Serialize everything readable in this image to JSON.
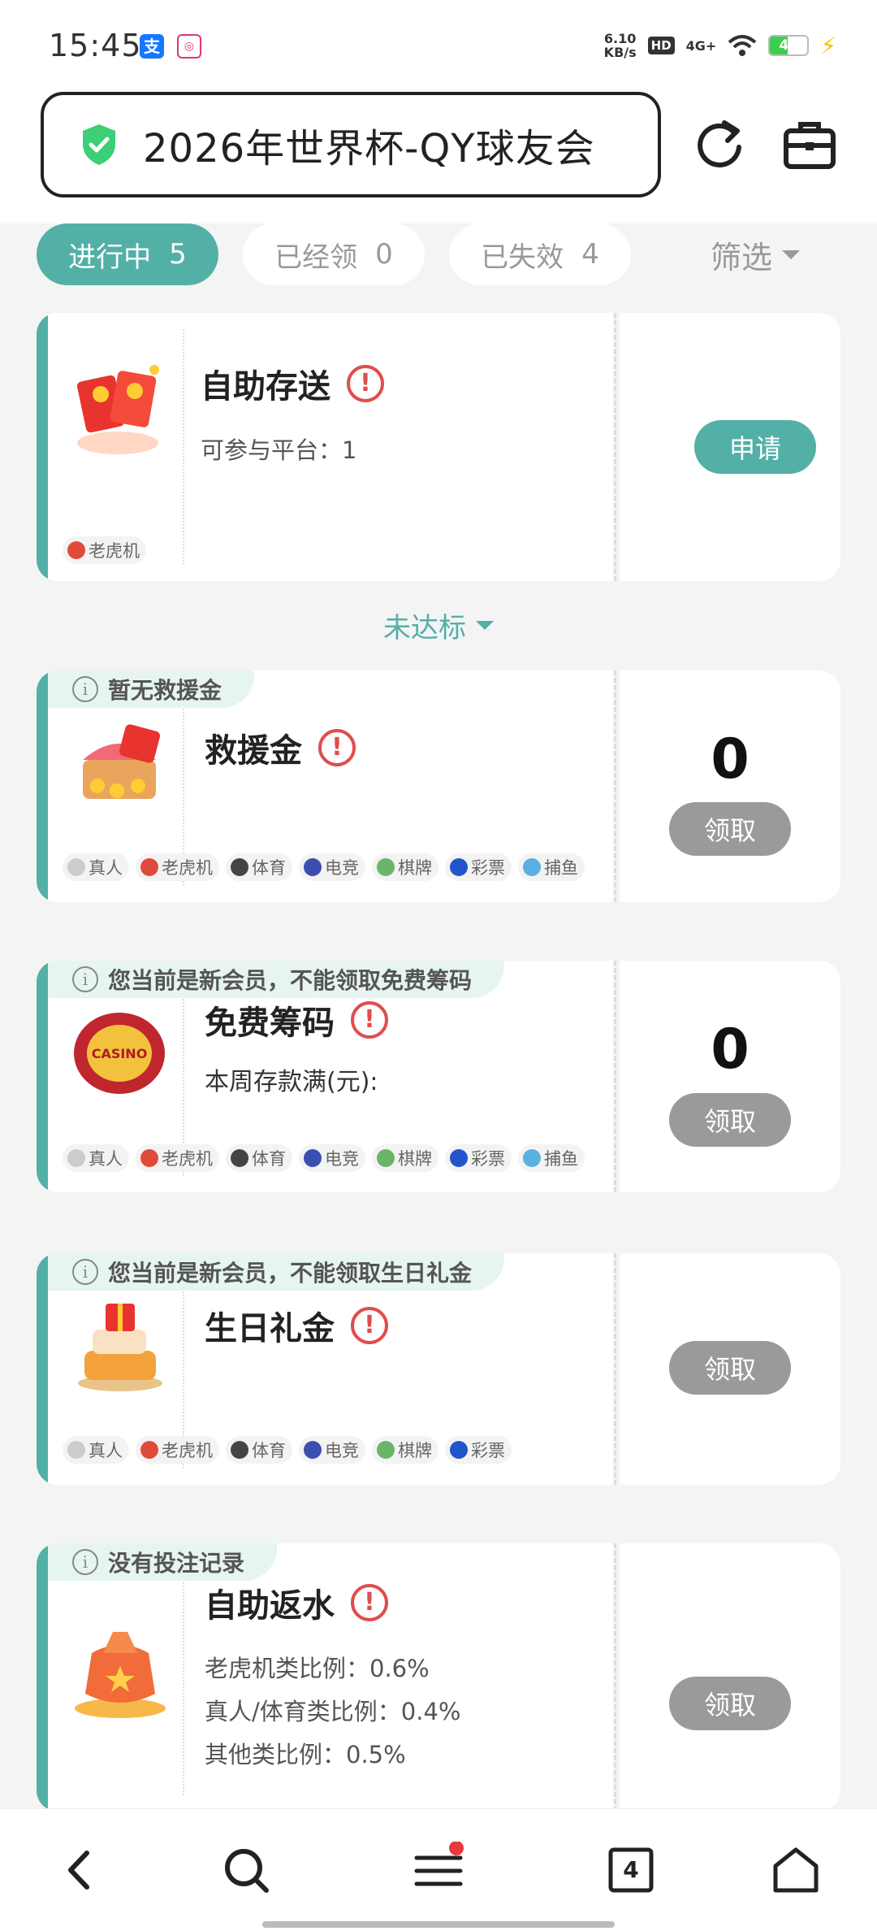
{
  "status_bar": {
    "time": "15:45",
    "app_icons": [
      "alipay-icon",
      "app-notify-icon"
    ],
    "net_speed_value": "6.10",
    "net_speed_unit": "KB/s",
    "hd": "HD",
    "network": "4G+",
    "battery": "47"
  },
  "header": {
    "title": "2026年世界杯-QY球友会",
    "shield_color": "#3ccf75"
  },
  "tabs": [
    {
      "label": "进行中",
      "count": "5"
    },
    {
      "label": "已经领",
      "count": "0"
    },
    {
      "label": "已失效",
      "count": "4"
    }
  ],
  "filter_label": "筛选",
  "divider_label": "未达标",
  "cards": {
    "deposit": {
      "title": "自助存送",
      "platforms": "可参与平台：1",
      "tag": "老虎机",
      "button": "申请"
    },
    "rescue": {
      "notice": "暂无救援金",
      "title": "救援金",
      "amount": "0",
      "button": "领取",
      "tags": [
        "真人",
        "老虎机",
        "体育",
        "电竞",
        "棋牌",
        "彩票",
        "捕鱼"
      ]
    },
    "chips": {
      "notice": "您当前是新会员，不能领取免费筹码",
      "title": "免费筹码",
      "text": "本周存款满(元):",
      "amount": "0",
      "button": "领取",
      "tags": [
        "真人",
        "老虎机",
        "体育",
        "电竞",
        "棋牌",
        "彩票",
        "捕鱼"
      ]
    },
    "birthday": {
      "notice": "您当前是新会员，不能领取生日礼金",
      "title": "生日礼金",
      "button": "领取",
      "tags": [
        "真人",
        "老虎机",
        "体育",
        "电竞",
        "棋牌",
        "彩票"
      ]
    },
    "rebate": {
      "notice": "没有投注记录",
      "title": "自助返水",
      "lines": [
        "老虎机类比例：0.6%",
        "真人/体育类比例：0.4%",
        "其他类比例：0.5%"
      ],
      "button": "领取"
    }
  },
  "colors": {
    "accent": "#53b0a6",
    "warn": "#e24c4c",
    "disabled": "#9a9a9a"
  },
  "nav": {
    "tab_count": "4"
  }
}
